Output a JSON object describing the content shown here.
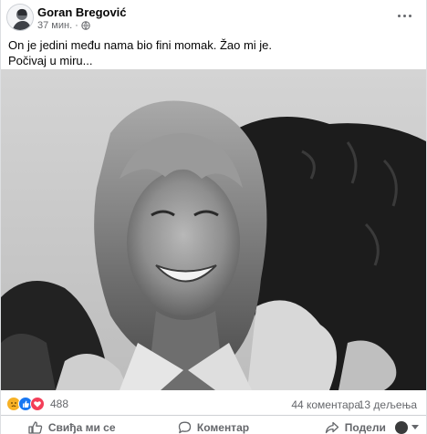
{
  "post": {
    "author": "Goran Bregović",
    "time": "37 мин.",
    "separator": "·",
    "text_lines": [
      "On je jedini među nama bio fini momak. Žao mi je.",
      "Počivaj u miru..."
    ],
    "privacy_icon": "globe-icon"
  },
  "stats": {
    "reaction_icons": [
      "sad-icon",
      "like-icon",
      "love-icon"
    ],
    "reaction_count": "488",
    "comments": "44 коментара",
    "shares": "13 дељења"
  },
  "actions": {
    "like": "Свиђа ми се",
    "comment": "Коментар",
    "share": "Подели"
  },
  "colors": {
    "like_blue": "#1877f2",
    "love_red": "#f33e58",
    "sad_yellow": "#f7b125",
    "muted_text": "#65676b"
  }
}
